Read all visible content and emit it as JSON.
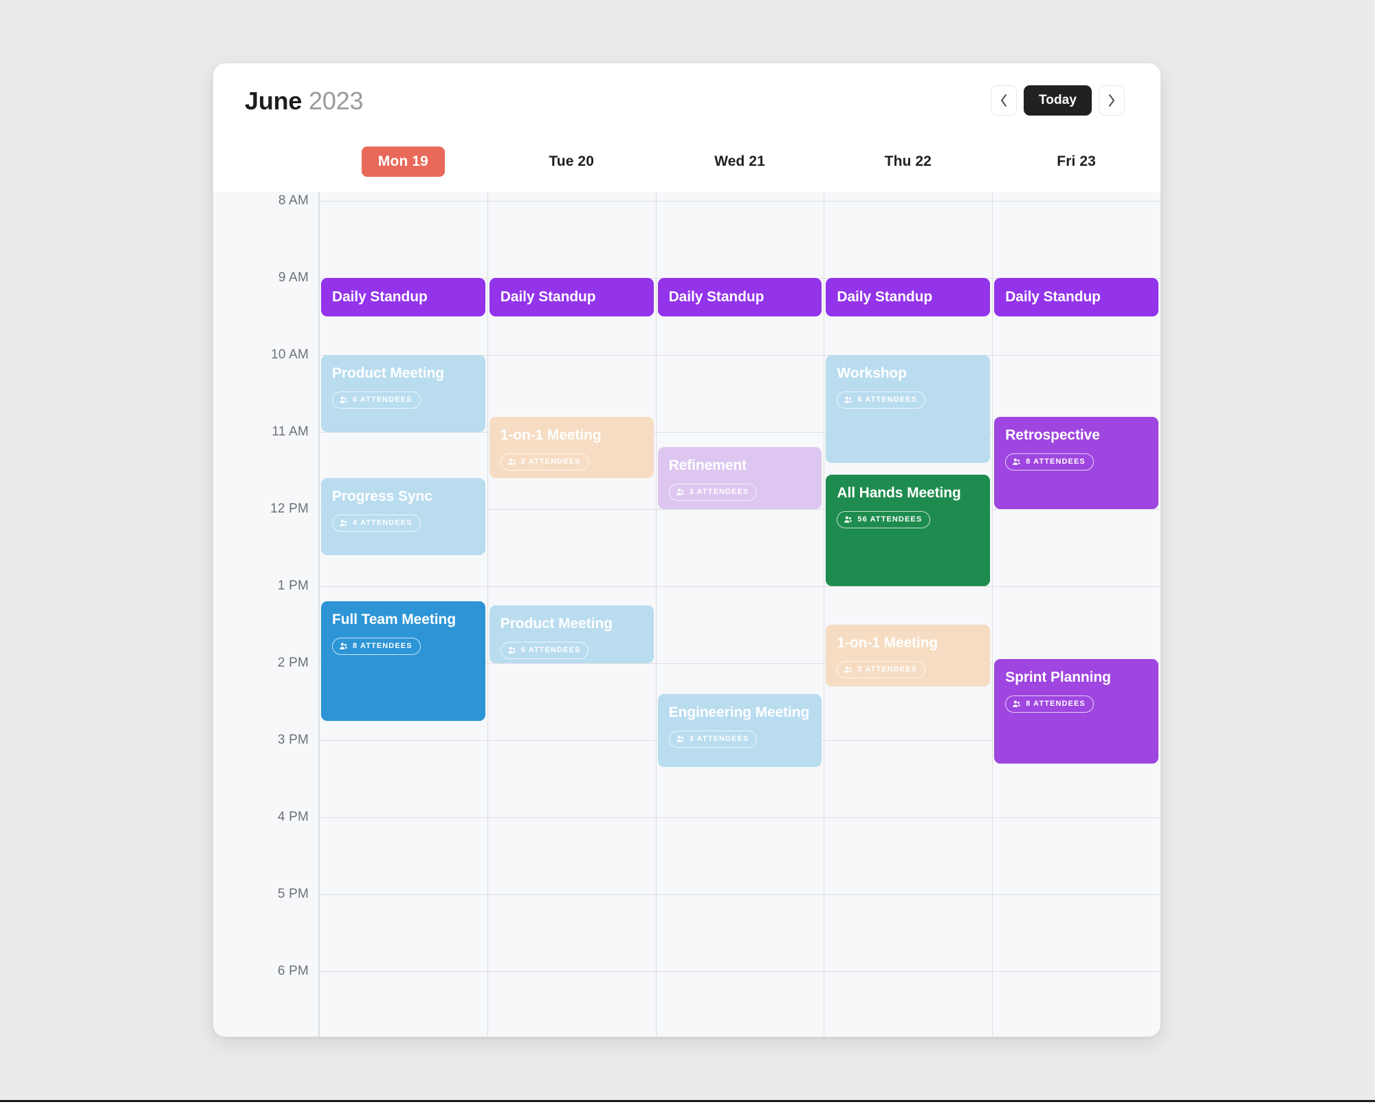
{
  "header": {
    "month": "June",
    "year": "2023",
    "prev_label": "‹",
    "next_label": "›",
    "today_label": "Today"
  },
  "days": [
    {
      "label": "Mon 19",
      "today": true
    },
    {
      "label": "Tue 20",
      "today": false
    },
    {
      "label": "Wed 21",
      "today": false
    },
    {
      "label": "Thu 22",
      "today": false
    },
    {
      "label": "Fri 23",
      "today": false
    }
  ],
  "time_labels": [
    "8 AM",
    "9 AM",
    "10 AM",
    "11 AM",
    "12 PM",
    "1 PM",
    "2 PM",
    "3 PM",
    "4 PM",
    "5 PM",
    "6 PM"
  ],
  "colors": {
    "today_pill": "#e8695a",
    "today_button": "#212121",
    "purple": "#9333ea",
    "purple_light": "#9f45e0",
    "light_blue": "#b9dcef",
    "blue": "#2d95d6",
    "peach": "#f5dcc2",
    "lavender": "#ddc6f0",
    "green": "#1e8c4e",
    "grid_line": "#dcdfe3",
    "grid_bg": "#f7f8fa"
  },
  "events": [
    {
      "title": "Daily Standup",
      "attendees": "",
      "day": 0,
      "start": 9.0,
      "end": 9.5,
      "color": "#9333ea",
      "text": "#ffffff",
      "badge": false
    },
    {
      "title": "Product Meeting",
      "attendees": "6 ATTENDEES",
      "day": 0,
      "start": 10.0,
      "end": 11.0,
      "color": "#b9dcef",
      "text": "#ffffff",
      "badge": true
    },
    {
      "title": "Progress Sync",
      "attendees": "4 ATTENDEES",
      "day": 0,
      "start": 11.6,
      "end": 12.6,
      "color": "#b9dcef",
      "text": "#ffffff",
      "badge": true
    },
    {
      "title": "Full Team Meeting",
      "attendees": "8 ATTENDEES",
      "day": 0,
      "start": 13.2,
      "end": 14.75,
      "color": "#2d95d6",
      "text": "#ffffff",
      "badge": true
    },
    {
      "title": "Daily Standup",
      "attendees": "",
      "day": 1,
      "start": 9.0,
      "end": 9.5,
      "color": "#9333ea",
      "text": "#ffffff",
      "badge": false
    },
    {
      "title": "1-on-1 Meeting",
      "attendees": "2 ATTENDEES",
      "day": 1,
      "start": 10.8,
      "end": 11.6,
      "color": "#f5dcc2",
      "text": "#ffffff",
      "badge": true
    },
    {
      "title": "Product Meeting",
      "attendees": "6 ATTENDEES",
      "day": 1,
      "start": 13.25,
      "end": 14.0,
      "color": "#b9dcef",
      "text": "#ffffff",
      "badge": true
    },
    {
      "title": "Daily Standup",
      "attendees": "",
      "day": 2,
      "start": 9.0,
      "end": 9.5,
      "color": "#9333ea",
      "text": "#ffffff",
      "badge": false
    },
    {
      "title": "Refinement",
      "attendees": "3 ATTENDEES",
      "day": 2,
      "start": 11.2,
      "end": 12.0,
      "color": "#ddc6f0",
      "text": "#ffffff",
      "badge": true
    },
    {
      "title": "Engineering Meeting",
      "attendees": "3 ATTENDEES",
      "day": 2,
      "start": 14.4,
      "end": 15.35,
      "color": "#b9dcef",
      "text": "#ffffff",
      "badge": true
    },
    {
      "title": "Daily Standup",
      "attendees": "",
      "day": 3,
      "start": 9.0,
      "end": 9.5,
      "color": "#9333ea",
      "text": "#ffffff",
      "badge": false
    },
    {
      "title": "Workshop",
      "attendees": "6 ATTENDEES",
      "day": 3,
      "start": 10.0,
      "end": 11.4,
      "color": "#b9dcef",
      "text": "#ffffff",
      "badge": true
    },
    {
      "title": "All Hands Meeting",
      "attendees": "56 ATTENDEES",
      "day": 3,
      "start": 11.55,
      "end": 13.0,
      "color": "#1e8c4e",
      "text": "#ffffff",
      "badge": true
    },
    {
      "title": "1-on-1 Meeting",
      "attendees": "2 ATTENDEES",
      "day": 3,
      "start": 13.5,
      "end": 14.3,
      "color": "#f5dcc2",
      "text": "#ffffff",
      "badge": true
    },
    {
      "title": "Daily Standup",
      "attendees": "",
      "day": 4,
      "start": 9.0,
      "end": 9.5,
      "color": "#9333ea",
      "text": "#ffffff",
      "badge": false
    },
    {
      "title": "Retrospective",
      "attendees": "8 ATTENDEES",
      "day": 4,
      "start": 10.8,
      "end": 12.0,
      "color": "#9f45e0",
      "text": "#ffffff",
      "badge": true
    },
    {
      "title": "Sprint Planning",
      "attendees": "8 ATTENDEES",
      "day": 4,
      "start": 13.95,
      "end": 15.3,
      "color": "#9f45e0",
      "text": "#ffffff",
      "badge": true
    }
  ]
}
